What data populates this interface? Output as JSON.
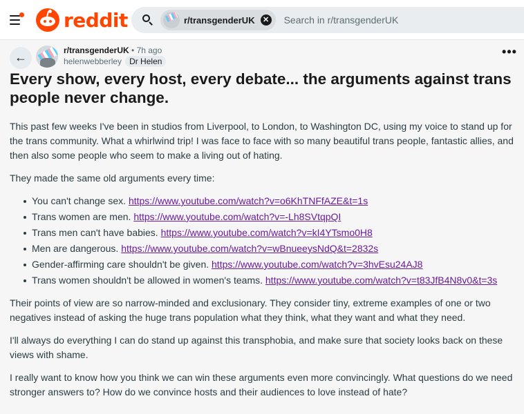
{
  "header": {
    "logo_text": "reddit",
    "search": {
      "chip_label": "r/transgenderUK",
      "placeholder": "Search in r/transgenderUK"
    }
  },
  "post": {
    "subreddit": "r/transgenderUK",
    "separator": "•",
    "time": "7h ago",
    "author": "helenwebberley",
    "flair": "Dr Helen",
    "more_label": "•••",
    "title": "Every show, every host, every debate... the arguments against trans people never change.",
    "paragraphs": [
      "This past few weeks I've been in studios from Liverpool, to London, to Washington DC, using my voice to stand up for the trans community. What a whirlwind trip! I was face to face with so many beautiful trans people, fantastic allies, and then also some people who seem to make a living out of hating.",
      "They made the same old arguments every time:"
    ],
    "arguments": [
      {
        "text": "You can't change sex.",
        "url": "https://www.youtube.com/watch?v=o6KhTNFfAZE&t=1s"
      },
      {
        "text": "Trans women are men.",
        "url": "https://www.youtube.com/watch?v=-Lh8SVtqpQI"
      },
      {
        "text": "Trans men can't have babies.",
        "url": "https://www.youtube.com/watch?v=kI4YTsmo0H8"
      },
      {
        "text": "Men are dangerous.",
        "url": "https://www.youtube.com/watch?v=wBnueeysNdQ&t=2832s"
      },
      {
        "text": "Gender-affirming care shouldn't be given.",
        "url": "https://www.youtube.com/watch?v=3hvEsu24AJ8"
      },
      {
        "text": "Trans women shouldn't be allowed in women's teams.",
        "url": "https://www.youtube.com/watch?v=t83JfB4N8v0&t=3s"
      }
    ],
    "closing": [
      "Their points of view are so narrow-minded and exclusionary. They consider tiny, extreme examples of one or two negatives instead of asking the huge trans population what they think, what they want and what they need.",
      "I'll always do everything I can do stand up against this transphobia, and make sure that society looks back on these views with shame.",
      "I really want to know how you think we can win these arguments even more convincingly. What questions do we need stronger answers to? How do we convince hosts and their audiences to love instead of hate?"
    ]
  },
  "colors": {
    "brand": "#ff4500",
    "link": "#6a1b9a",
    "background": "#f6f6f6"
  }
}
